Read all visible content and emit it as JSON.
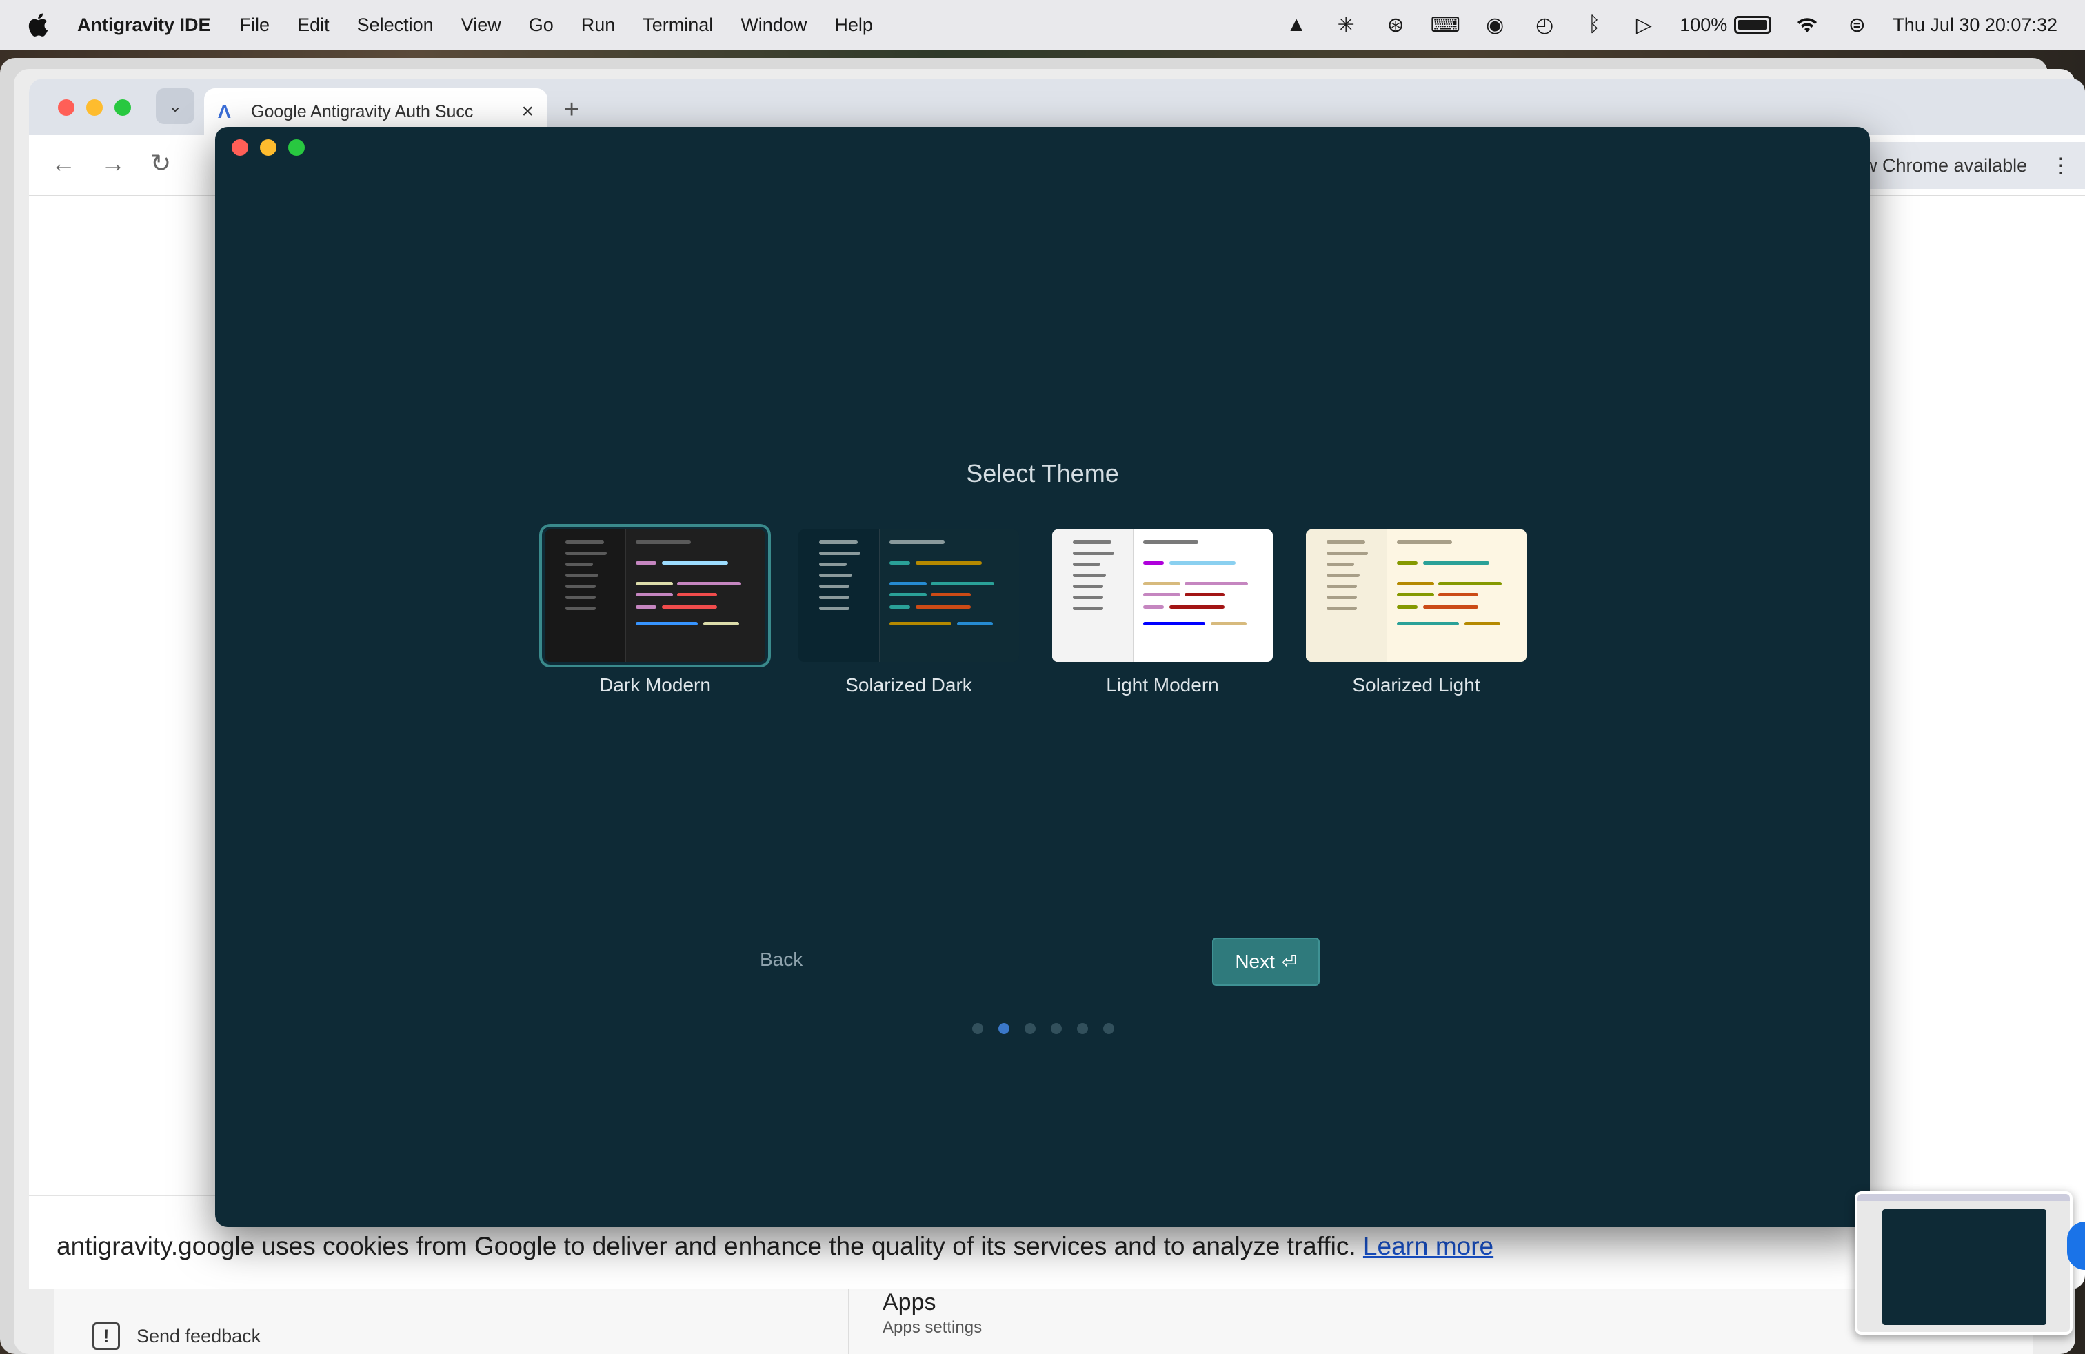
{
  "menubar": {
    "app_name": "Antigravity IDE",
    "items": [
      "File",
      "Edit",
      "Selection",
      "View",
      "Go",
      "Run",
      "Terminal",
      "Window",
      "Help"
    ],
    "battery_percent": "100%",
    "datetime": "Thu Jul 30  20:07:32"
  },
  "browser": {
    "tab_title": "Google Antigravity Auth Succ",
    "update_text": "ew Chrome available"
  },
  "ide": {
    "title": "Select Theme",
    "selected_theme": "Dark Modern",
    "themes": [
      {
        "name": "Dark Modern",
        "bg": "#1f1f1f",
        "side": "#181818",
        "bar": "#2a2a2a",
        "line": "#5a5a5a",
        "c": [
          "#c586c0",
          "#9cdcfe",
          "#dcdcaa",
          "#c586c0",
          "#c586c0",
          "#f14c4c",
          "#c586c0",
          "#f14c4c",
          "#3794ff",
          "#dcdcaa"
        ]
      },
      {
        "name": "Solarized Dark",
        "bg": "#0f2b35",
        "side": "#0a2530",
        "bar": "#0f2b35",
        "line": "#8a9a9c",
        "c": [
          "#2aa198",
          "#b58900",
          "#268bd2",
          "#2aa198",
          "#2aa198",
          "#cb4b16",
          "#2aa198",
          "#cb4b16",
          "#b58900",
          "#268bd2"
        ]
      },
      {
        "name": "Light Modern",
        "bg": "#ffffff",
        "side": "#f3f3f3",
        "bar": "#f3f3f3",
        "line": "#7a7a7a",
        "c": [
          "#af00db",
          "#8ad0f0",
          "#d7ba7d",
          "#c586c0",
          "#c586c0",
          "#a31515",
          "#c586c0",
          "#a31515",
          "#0000ff",
          "#d7ba7d"
        ]
      },
      {
        "name": "Solarized Light",
        "bg": "#fdf6e3",
        "side": "#f5efdc",
        "bar": "#fdf6e3",
        "line": "#a89f88",
        "c": [
          "#859900",
          "#2aa198",
          "#b58900",
          "#859900",
          "#859900",
          "#cb4b16",
          "#859900",
          "#cb4b16",
          "#2aa198",
          "#b58900"
        ]
      }
    ],
    "back_label": "Back",
    "next_label": "Next",
    "pager": {
      "count": 6,
      "active": 2
    }
  },
  "cookie": {
    "text": "antigravity.google uses cookies from Google to deliver and enhance the quality of its services and to analyze traffic. ",
    "link": "Learn more"
  },
  "settings": {
    "feedback": "Send feedback",
    "apps_title": "Apps",
    "apps_subtitle": "Apps settings"
  },
  "icons": [
    "apple-icon",
    "wifi-icon",
    "bluetooth-icon",
    "battery-icon",
    "control-center-icon"
  ]
}
